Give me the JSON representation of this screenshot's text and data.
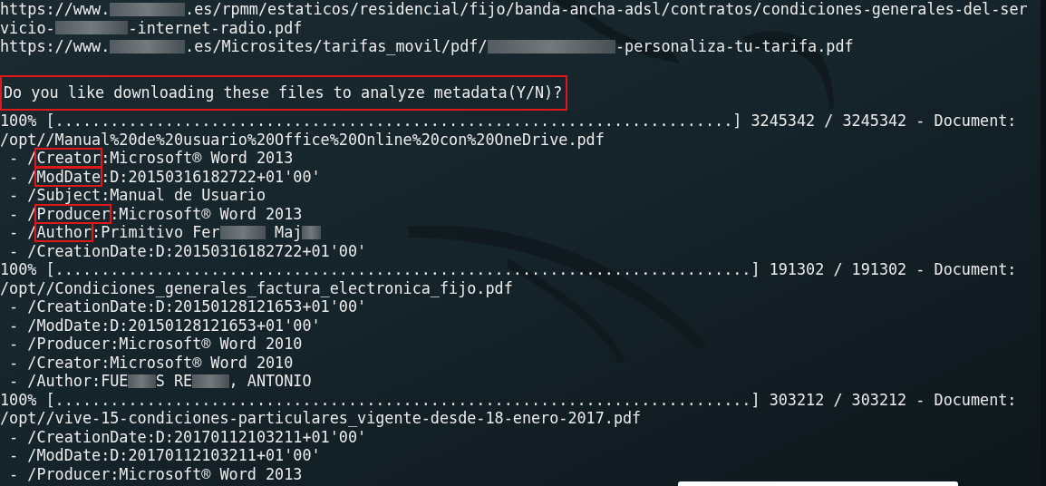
{
  "terminal": {
    "lines": [
      {
        "kind": "url",
        "parts": [
          "https://www.",
          {
            "kind": "redacted"
          },
          ".es/rpmm/estaticos/residencial/fijo/banda-ancha-adsl/contratos/condiciones-generales-del-ser"
        ]
      },
      {
        "kind": "url",
        "parts": [
          "vicio-",
          {
            "kind": "redacted"
          },
          "-internet-radio.pdf"
        ]
      },
      {
        "kind": "url",
        "parts": [
          "https://www.",
          {
            "kind": "redacted"
          },
          ".es/Microsites/tarifas_movil/pdf/",
          {
            "kind": "redacted"
          },
          "-personaliza-tu-tarifa.pdf"
        ]
      },
      {
        "kind": "prompt",
        "highlighted": true,
        "parts": [
          "Do you like downloading these files to analyze metadata(Y/N)?"
        ]
      },
      {
        "kind": "progress",
        "parts": [
          "100% [..........................................................................] 3245342 / 3245342 - Document:"
        ]
      },
      {
        "kind": "file",
        "parts": [
          "/opt//Manual%20de%20usuario%20Office%20Online%20con%20OneDrive.pdf"
        ]
      },
      {
        "kind": "meta",
        "parts": [
          " - /",
          {
            "text": "Creator",
            "highlighted": true
          },
          ":Microsoft® Word 2013"
        ]
      },
      {
        "kind": "meta",
        "parts": [
          " - /",
          {
            "text": "ModDate",
            "highlighted": true
          },
          ":D:20150316182722+01'00'"
        ]
      },
      {
        "kind": "meta",
        "parts": [
          " - /Subject:Manual de Usuario"
        ]
      },
      {
        "kind": "meta",
        "parts": [
          " - /",
          {
            "text": "Producer",
            "highlighted": true
          },
          ":Microsoft® Word 2013"
        ]
      },
      {
        "kind": "meta",
        "parts": [
          " - /",
          {
            "text": "Author",
            "highlighted": true
          },
          ":Primitivo Fer",
          {
            "kind": "redacted"
          },
          " Maj",
          {
            "kind": "redacted"
          }
        ]
      },
      {
        "kind": "meta",
        "parts": [
          " - /CreationDate:D:20150316182722+01'00'"
        ]
      },
      {
        "kind": "progress",
        "parts": [
          "100% [............................................................................] 191302 / 191302 - Document:"
        ]
      },
      {
        "kind": "file",
        "parts": [
          "/opt//Condiciones_generales_factura_electronica_fijo.pdf"
        ]
      },
      {
        "kind": "meta",
        "parts": [
          " - /CreationDate:D:20150128121653+01'00'"
        ]
      },
      {
        "kind": "meta",
        "parts": [
          " - /ModDate:D:20150128121653+01'00'"
        ]
      },
      {
        "kind": "meta",
        "parts": [
          " - /Producer:Microsoft® Word 2010"
        ]
      },
      {
        "kind": "meta",
        "parts": [
          " - /Creator:Microsoft® Word 2010"
        ]
      },
      {
        "kind": "meta",
        "parts": [
          " - /Author:FUE",
          {
            "kind": "redacted"
          },
          "S RE",
          {
            "kind": "redacted"
          },
          ", ANTONIO"
        ]
      },
      {
        "kind": "progress",
        "parts": [
          "100% [............................................................................] 303212 / 303212 - Document:"
        ]
      },
      {
        "kind": "file",
        "parts": [
          "/opt//vive-15-condiciones-particulares_vigente-desde-18-enero-2017.pdf"
        ]
      },
      {
        "kind": "meta",
        "parts": [
          " - /CreationDate:D:20170112103211+01'00'"
        ]
      },
      {
        "kind": "meta",
        "parts": [
          " - /ModDate:D:20170112103211+01'00'"
        ]
      },
      {
        "kind": "meta",
        "parts": [
          " - /Producer:Microsoft® Word 2013"
        ]
      }
    ]
  }
}
